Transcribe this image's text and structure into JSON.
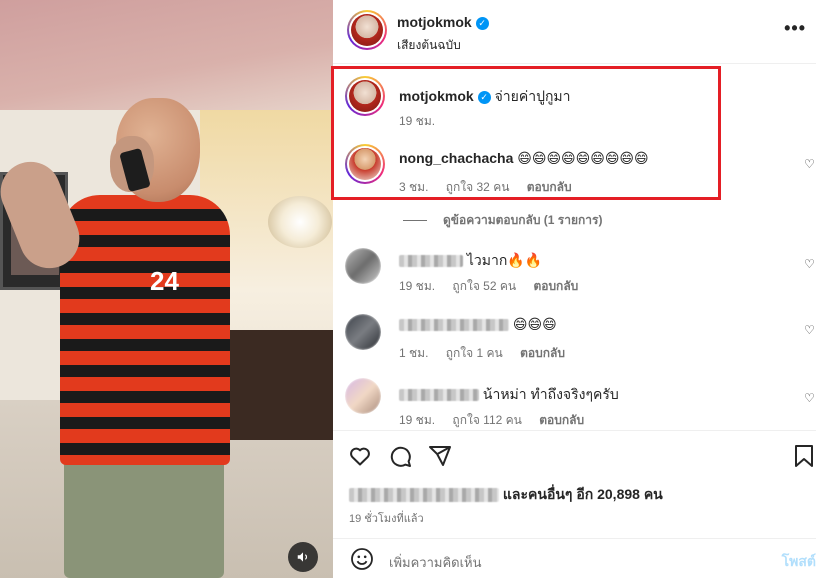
{
  "post": {
    "author": "motjokmok",
    "audio_label": "เสียงต้นฉบับ",
    "verified": true
  },
  "comments": [
    {
      "username": "motjokmok",
      "verified": true,
      "text": "จ่ายค่าปูกูมา",
      "time": "19 ชม.",
      "highlighted": true
    },
    {
      "username": "nong_chachacha",
      "text": "😄😄😄😄😄😄😄😄😄",
      "time": "3 ชม.",
      "likes": "ถูกใจ 32 คน",
      "reply": "ตอบกลับ",
      "highlighted": true
    }
  ],
  "view_replies": "ดูข้อความตอบกลับ (1 รายการ)",
  "other_comments": [
    {
      "text": "ไวมาก🔥🔥",
      "time": "19 ชม.",
      "likes": "ถูกใจ 52 คน",
      "reply": "ตอบกลับ"
    },
    {
      "text": "😄😄😄",
      "time": "1 ชม.",
      "likes": "ถูกใจ 1 คน",
      "reply": "ตอบกลับ"
    },
    {
      "text": "น้าหม่า ทำถึงจริงๆครับ",
      "time": "19 ชม.",
      "likes": "ถูกใจ 112 คน",
      "reply": "ตอบกลับ"
    }
  ],
  "photo": {
    "jersey_number": "24"
  },
  "footer": {
    "likes_text": "และคนอื่นๆ อีก 20,898 คน",
    "time_ago": "19 ชั่วโมงที่แล้ว",
    "comment_placeholder": "เพิ่มความคิดเห็น",
    "post_label": "โพสต์"
  },
  "colors": {
    "highlight_border": "#e41e25",
    "verified_blue": "#0095f6",
    "accent": "#0095f6"
  }
}
